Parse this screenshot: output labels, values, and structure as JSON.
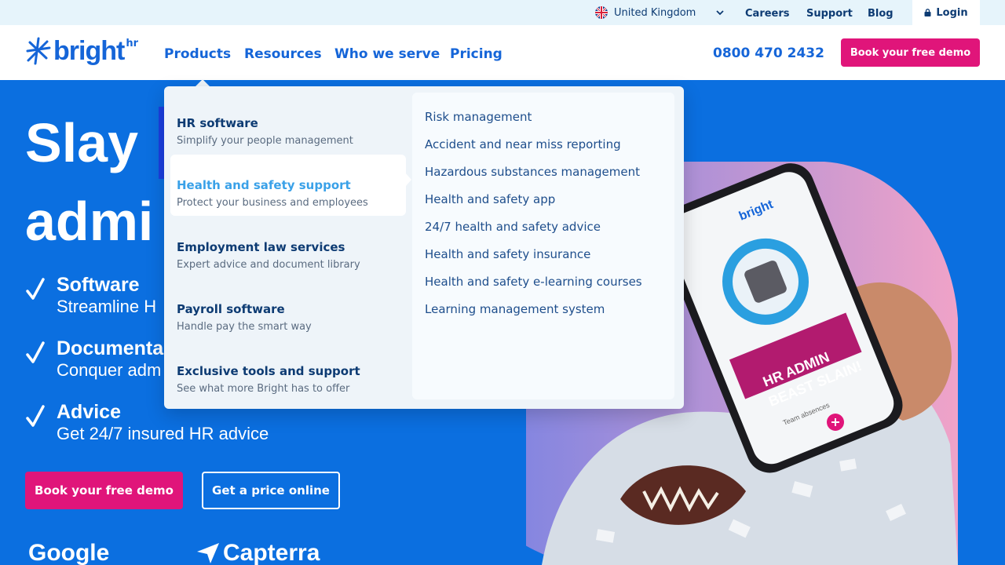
{
  "utility_bar": {
    "region": "United Kingdom",
    "links": [
      "Careers",
      "Support",
      "Blog"
    ],
    "login": "Login"
  },
  "header": {
    "logo_text": "bright",
    "logo_suffix": "hr",
    "nav": [
      "Products",
      "Resources",
      "Who we serve",
      "Pricing"
    ],
    "phone": "0800 470 2432",
    "cta": "Book your free demo"
  },
  "hero": {
    "title_line1": "Slay",
    "title_line2": "admi",
    "features": [
      {
        "title": "Software",
        "subtitle": "Streamline H"
      },
      {
        "title": "Documenta",
        "subtitle": "Conquer adm"
      },
      {
        "title": "Advice",
        "subtitle": "Get 24/7 insured HR advice"
      }
    ],
    "cta_primary": "Book your free demo",
    "cta_secondary": "Get a price online",
    "review_logos": [
      "Google",
      "Capterra"
    ]
  },
  "dropdown": {
    "categories": [
      {
        "title": "HR software",
        "description": "Simplify your people management"
      },
      {
        "title": "Health and safety support",
        "description": "Protect your business and employees"
      },
      {
        "title": "Employment law services",
        "description": "Expert advice and document library"
      },
      {
        "title": "Payroll software",
        "description": "Handle pay the smart way"
      },
      {
        "title": "Exclusive tools and support",
        "description": "See what more Bright has to offer"
      }
    ],
    "active_index": 1,
    "links": [
      "Risk management",
      "Accident and near miss reporting",
      "Hazardous substances management",
      "Health and safety app",
      "24/7 health and safety advice",
      "Health and safety insurance",
      "Health and safety e-learning courses",
      "Learning management system"
    ]
  },
  "phone_screen": {
    "brand": "bright",
    "banner_line1": "HR ADMIN",
    "banner_line2": "BEAST SLAIN!",
    "caption": "Team absences"
  },
  "colors": {
    "brand_blue": "#1565d8",
    "hero_blue": "#0b6fe0",
    "cta_pink": "#e0157a",
    "navy": "#0d3b73",
    "active_link": "#3aa1e8"
  }
}
